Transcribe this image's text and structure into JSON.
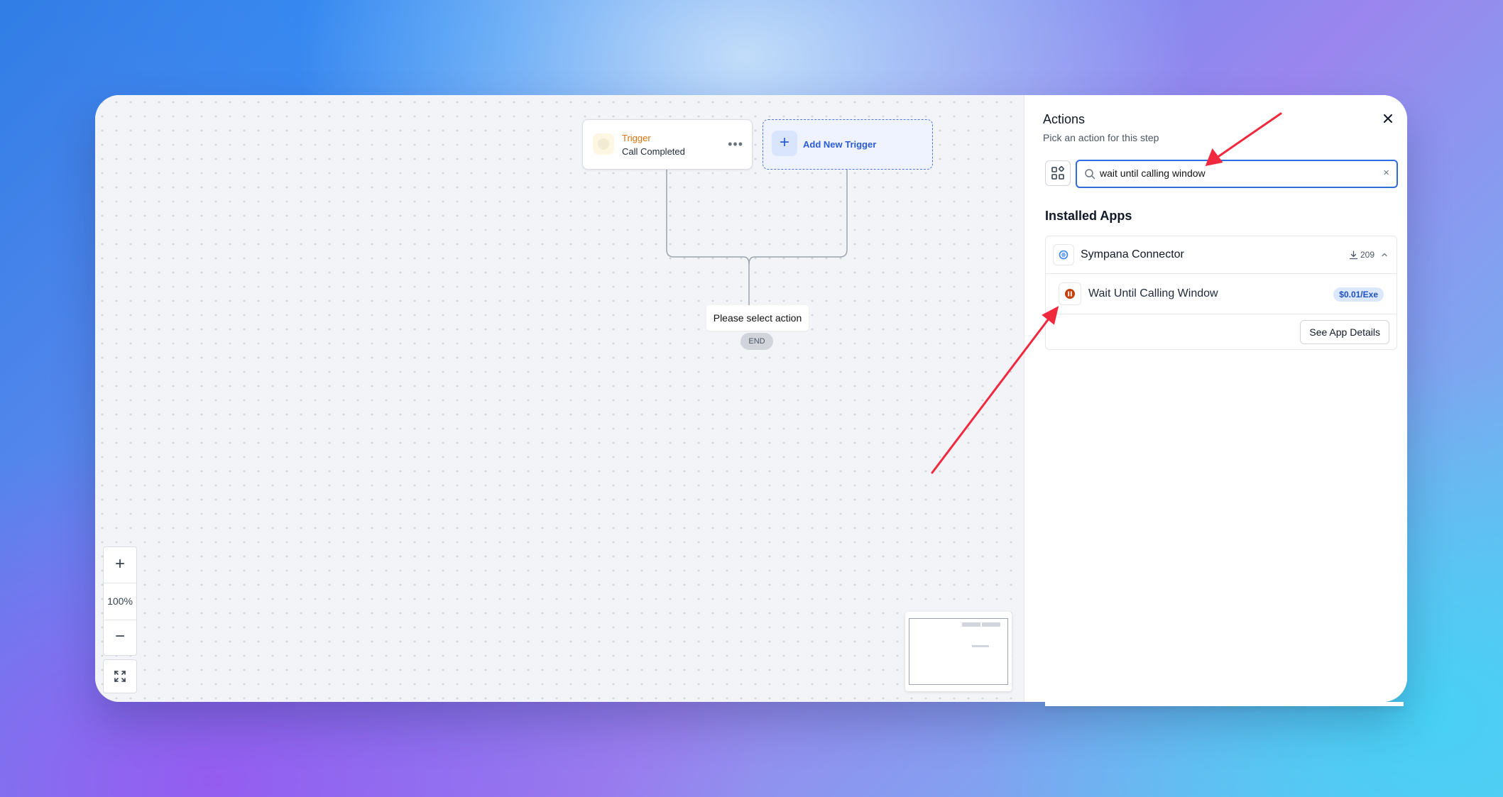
{
  "canvas": {
    "trigger": {
      "title": "Trigger",
      "subtitle": "Call Completed",
      "menu_icon": "more-horizontal-icon"
    },
    "add_trigger": {
      "label": "Add New Trigger",
      "icon": "plus-icon"
    },
    "placeholder_node": "Please select action",
    "end_badge": "END",
    "zoom": {
      "level": "100%",
      "in_icon": "plus-icon",
      "out_icon": "minus-icon",
      "fit_icon": "expand-icon"
    }
  },
  "panel": {
    "title": "Actions",
    "subtitle": "Pick an action for this step",
    "search": {
      "value": "wait until calling window"
    },
    "section_title": "Installed Apps",
    "app": {
      "name": "Sympana Connector",
      "count": "209",
      "action": {
        "name": "Wait Until Calling Window",
        "price": "$0.01/Exe"
      },
      "details_label": "See App Details"
    }
  },
  "colors": {
    "accent": "#2f6bde",
    "trigger_title": "#d9730d",
    "annotation_arrow": "#f0293e",
    "price_badge_bg": "#dbe7fd"
  }
}
